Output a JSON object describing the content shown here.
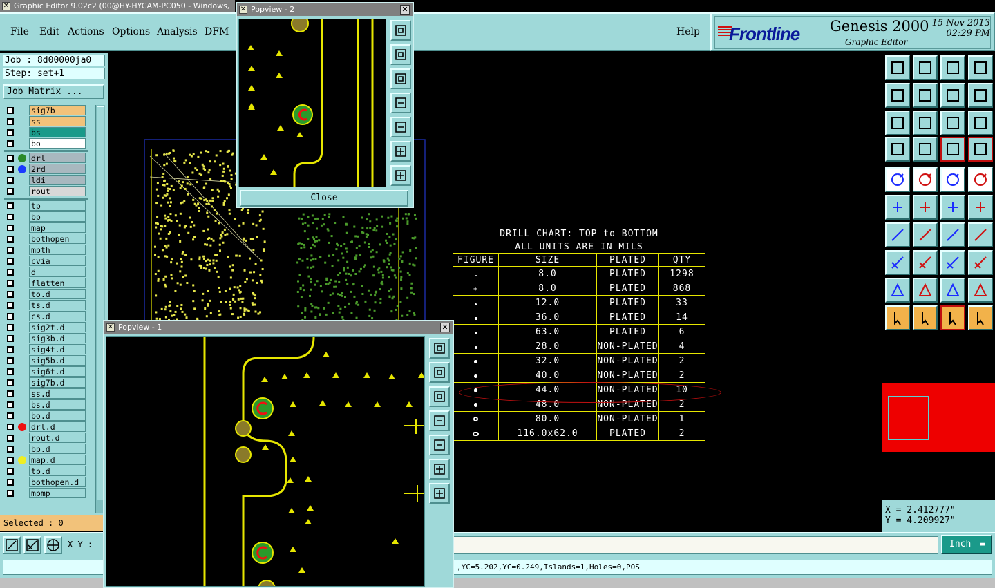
{
  "window": {
    "title": "Graphic Editor 9.02c2 (00@HY-HYCAM-PC050 - Windows,"
  },
  "menu": {
    "items": [
      "File",
      "Edit",
      "Actions",
      "Options",
      "Analysis",
      "DFM"
    ],
    "help": "Help"
  },
  "logo": {
    "brand": "Frontline",
    "product": "Genesis 2000",
    "subtitle": "Graphic Editor",
    "date": "15 Nov 2013",
    "time": "02:29 PM"
  },
  "job": {
    "job_label": "Job : 8d00000ja0",
    "step_label": "Step: set+1",
    "matrix_button": "Job Matrix ..."
  },
  "layers": [
    {
      "name": "sig7b",
      "bg": "#f2c27a",
      "dot": ""
    },
    {
      "name": "ss",
      "bg": "#f2c27a",
      "dot": ""
    },
    {
      "name": "bs",
      "bg": "#1a9a8a",
      "dot": ""
    },
    {
      "name": "bo",
      "bg": "#ffffff",
      "dot": ""
    },
    {
      "name": "drl",
      "bg": "#a8b8bf",
      "dot": "#2a8a2a"
    },
    {
      "name": "2rd",
      "bg": "#a8b8bf",
      "dot": "#1a3aff"
    },
    {
      "name": "ldi",
      "bg": "#a8b8bf",
      "dot": ""
    },
    {
      "name": "rout",
      "bg": "#d8d8d8",
      "dot": ""
    },
    {
      "name": "tp",
      "bg": "#9fd9d9",
      "dot": ""
    },
    {
      "name": "bp",
      "bg": "#9fd9d9",
      "dot": ""
    },
    {
      "name": "map",
      "bg": "#9fd9d9",
      "dot": ""
    },
    {
      "name": "bothopen",
      "bg": "#9fd9d9",
      "dot": ""
    },
    {
      "name": "mpth",
      "bg": "#9fd9d9",
      "dot": ""
    },
    {
      "name": "cvia",
      "bg": "#9fd9d9",
      "dot": ""
    },
    {
      "name": "d",
      "bg": "#9fd9d9",
      "dot": ""
    },
    {
      "name": "flatten",
      "bg": "#9fd9d9",
      "dot": ""
    },
    {
      "name": "to.d",
      "bg": "#9fd9d9",
      "dot": ""
    },
    {
      "name": "ts.d",
      "bg": "#9fd9d9",
      "dot": ""
    },
    {
      "name": "cs.d",
      "bg": "#9fd9d9",
      "dot": ""
    },
    {
      "name": "sig2t.d",
      "bg": "#9fd9d9",
      "dot": ""
    },
    {
      "name": "sig3b.d",
      "bg": "#9fd9d9",
      "dot": ""
    },
    {
      "name": "sig4t.d",
      "bg": "#9fd9d9",
      "dot": ""
    },
    {
      "name": "sig5b.d",
      "bg": "#9fd9d9",
      "dot": ""
    },
    {
      "name": "sig6t.d",
      "bg": "#9fd9d9",
      "dot": ""
    },
    {
      "name": "sig7b.d",
      "bg": "#9fd9d9",
      "dot": ""
    },
    {
      "name": "ss.d",
      "bg": "#9fd9d9",
      "dot": ""
    },
    {
      "name": "bs.d",
      "bg": "#9fd9d9",
      "dot": ""
    },
    {
      "name": "bo.d",
      "bg": "#9fd9d9",
      "dot": ""
    },
    {
      "name": "drl.d",
      "bg": "#9fd9d9",
      "dot": "#ee1111"
    },
    {
      "name": "rout.d",
      "bg": "#9fd9d9",
      "dot": ""
    },
    {
      "name": "bp.d",
      "bg": "#9fd9d9",
      "dot": ""
    },
    {
      "name": "map.d",
      "bg": "#9fd9d9",
      "dot": "#eeee22"
    },
    {
      "name": "tp.d",
      "bg": "#9fd9d9",
      "dot": ""
    },
    {
      "name": "bothopen.d",
      "bg": "#9fd9d9",
      "dot": ""
    },
    {
      "name": "mpmp",
      "bg": "#9fd9d9",
      "dot": ""
    }
  ],
  "selected": "Selected : 0",
  "xy_label": "X Y :",
  "units": "Inch",
  "status": ",YC=5.202,YC=0.249,Islands=1,Holes=0,POS",
  "coords": {
    "x": "X = 2.412777\"",
    "y": "Y = 4.209927\""
  },
  "drill_chart": {
    "title": "DRILL CHART: TOP to BOTTOM",
    "units_note": "ALL UNITS ARE IN MILS",
    "headers": [
      "FIGURE",
      "SIZE",
      "PLATED",
      "QTY"
    ],
    "rows": [
      {
        "size": "8.0",
        "plated": "PLATED",
        "qty": "1298"
      },
      {
        "size": "8.0",
        "plated": "PLATED",
        "qty": "868"
      },
      {
        "size": "12.0",
        "plated": "PLATED",
        "qty": "33"
      },
      {
        "size": "36.0",
        "plated": "PLATED",
        "qty": "14"
      },
      {
        "size": "63.0",
        "plated": "PLATED",
        "qty": "6"
      },
      {
        "size": "28.0",
        "plated": "NON-PLATED",
        "qty": "4"
      },
      {
        "size": "32.0",
        "plated": "NON-PLATED",
        "qty": "2"
      },
      {
        "size": "40.0",
        "plated": "NON-PLATED",
        "qty": "2"
      },
      {
        "size": "44.0",
        "plated": "NON-PLATED",
        "qty": "10"
      },
      {
        "size": "48.0",
        "plated": "NON-PLATED",
        "qty": "2"
      },
      {
        "size": "80.0",
        "plated": "NON-PLATED",
        "qty": "1"
      },
      {
        "size": "116.0x62.0",
        "plated": "PLATED",
        "qty": "2"
      }
    ]
  },
  "popview1": {
    "title": "Popview - 1"
  },
  "popview2": {
    "title": "Popview - 2",
    "close_label": "Close"
  },
  "colors": {
    "panel": "#9fd9d9",
    "trace": "#e6e600",
    "pad_green": "#2a9a2a",
    "highlight": "#c01010"
  }
}
